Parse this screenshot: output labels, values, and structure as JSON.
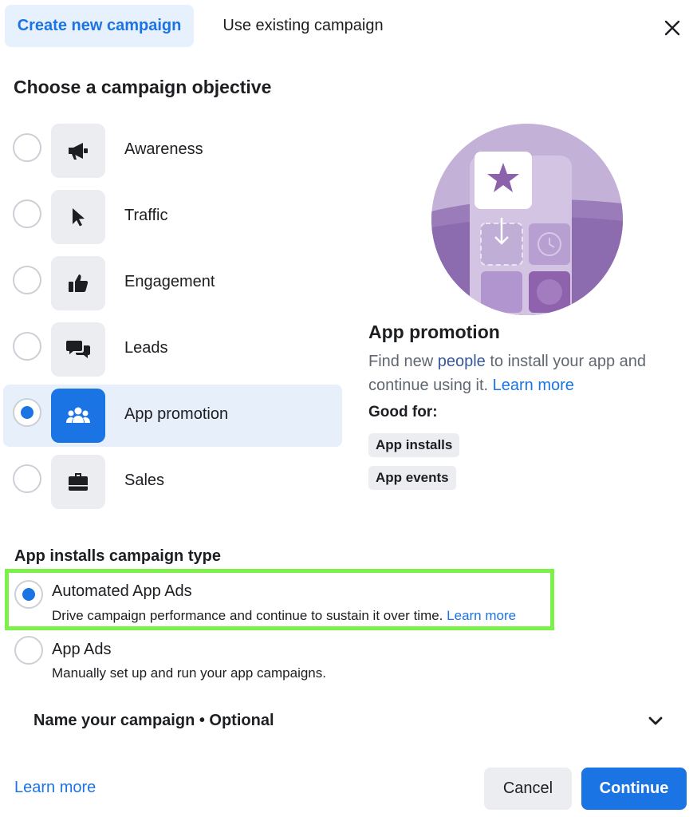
{
  "tabs": {
    "create": "Create new campaign",
    "existing": "Use existing campaign"
  },
  "heading": "Choose a campaign objective",
  "objectives": [
    {
      "label": "Awareness",
      "icon": "megaphone-icon",
      "selected": false
    },
    {
      "label": "Traffic",
      "icon": "cursor-icon",
      "selected": false
    },
    {
      "label": "Engagement",
      "icon": "thumbs-up-icon",
      "selected": false
    },
    {
      "label": "Leads",
      "icon": "chat-bubbles-icon",
      "selected": false
    },
    {
      "label": "App promotion",
      "icon": "people-group-icon",
      "selected": true
    },
    {
      "label": "Sales",
      "icon": "briefcase-icon",
      "selected": false
    }
  ],
  "detail": {
    "title": "App promotion",
    "desc_part1": "Find new ",
    "desc_people": "people",
    "desc_part2": " to install your app and continue using it. ",
    "learn_more": "Learn more",
    "good_for_label": "Good for:",
    "good_for": [
      "App installs",
      "App events"
    ]
  },
  "campaign_type": {
    "heading": "App installs campaign type",
    "options": [
      {
        "title": "Automated App Ads",
        "desc": "Drive campaign performance and continue to sustain it over time.",
        "learn_more": "Learn more",
        "selected": true
      },
      {
        "title": "App Ads",
        "desc": "Manually set up and run your app campaigns.",
        "selected": false
      }
    ]
  },
  "name_campaign": "Name your campaign • Optional",
  "footer": {
    "learn_more": "Learn more",
    "cancel": "Cancel",
    "continue": "Continue"
  },
  "colors": {
    "accent": "#1b74e4",
    "selected_bg": "#e7effb",
    "highlight": "#7ef04a",
    "illustration": "#b29cc9"
  }
}
